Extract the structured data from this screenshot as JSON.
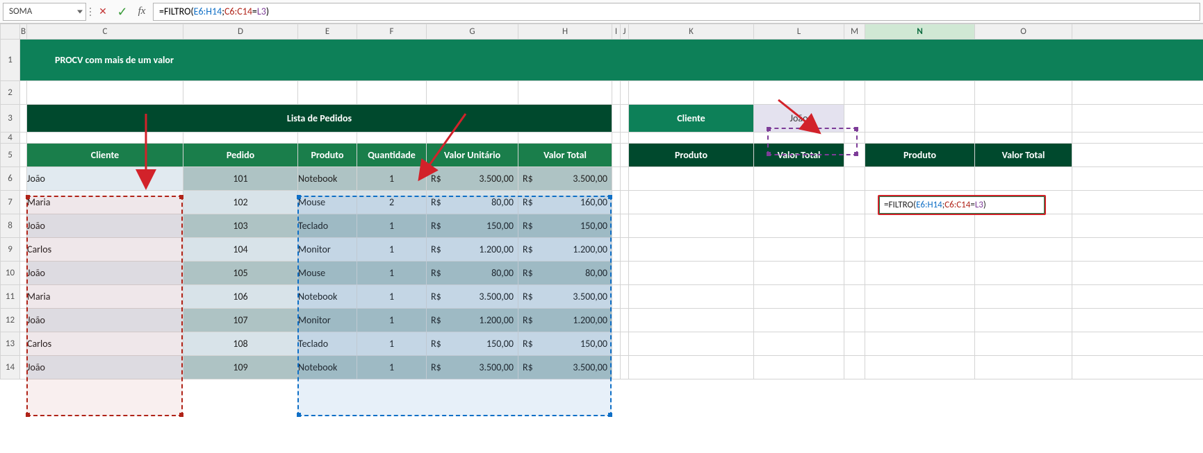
{
  "namebox": "SOMA",
  "formula": {
    "prefix": "=FILTRO(",
    "r1": "E6:H14",
    "sep": ";",
    "r2": "C6:C14",
    "eq": "=",
    "r3": "L3",
    "suffix": ")"
  },
  "columns": [
    "",
    "B",
    "C",
    "D",
    "E",
    "F",
    "G",
    "H",
    "I",
    "J",
    "K",
    "L",
    "M",
    "N",
    "O"
  ],
  "title": "PROCV com mais de um valor",
  "lista_header": "Lista de Pedidos",
  "table_headers": {
    "cliente": "Cliente",
    "pedido": "Pedido",
    "produto": "Produto",
    "quantidade": "Quantidade",
    "valor_unit": "Valor Unitário",
    "valor_total": "Valor Total"
  },
  "cliente_label": "Cliente",
  "cliente_value": "João",
  "right_headers": {
    "produto": "Produto",
    "valor_total": "Valor Total"
  },
  "currency": "R$",
  "rows": [
    {
      "cliente": "João",
      "pedido": "101",
      "produto": "Notebook",
      "qtd": "1",
      "unit": "3.500,00",
      "total": "3.500,00"
    },
    {
      "cliente": "Maria",
      "pedido": "102",
      "produto": "Mouse",
      "qtd": "2",
      "unit": "80,00",
      "total": "160,00"
    },
    {
      "cliente": "João",
      "pedido": "103",
      "produto": "Teclado",
      "qtd": "1",
      "unit": "150,00",
      "total": "150,00"
    },
    {
      "cliente": "Carlos",
      "pedido": "104",
      "produto": "Monitor",
      "qtd": "1",
      "unit": "1.200,00",
      "total": "1.200,00"
    },
    {
      "cliente": "João",
      "pedido": "105",
      "produto": "Mouse",
      "qtd": "1",
      "unit": "80,00",
      "total": "80,00"
    },
    {
      "cliente": "Maria",
      "pedido": "106",
      "produto": "Notebook",
      "qtd": "1",
      "unit": "3.500,00",
      "total": "3.500,00"
    },
    {
      "cliente": "João",
      "pedido": "107",
      "produto": "Monitor",
      "qtd": "1",
      "unit": "1.200,00",
      "total": "1.200,00"
    },
    {
      "cliente": "Carlos",
      "pedido": "108",
      "produto": "Teclado",
      "qtd": "1",
      "unit": "150,00",
      "total": "150,00"
    },
    {
      "cliente": "João",
      "pedido": "109",
      "produto": "Notebook",
      "qtd": "1",
      "unit": "3.500,00",
      "total": "3.500,00"
    }
  ],
  "row_numbers": [
    "1",
    "2",
    "3",
    "4",
    "5",
    "6",
    "7",
    "8",
    "9",
    "10",
    "11",
    "12",
    "13",
    "14"
  ],
  "chart_data": {
    "type": "table",
    "columns": [
      "Cliente",
      "Pedido",
      "Produto",
      "Quantidade",
      "Valor Unitário",
      "Valor Total"
    ],
    "data": [
      [
        "João",
        101,
        "Notebook",
        1,
        3500.0,
        3500.0
      ],
      [
        "Maria",
        102,
        "Mouse",
        2,
        80.0,
        160.0
      ],
      [
        "João",
        103,
        "Teclado",
        1,
        150.0,
        150.0
      ],
      [
        "Carlos",
        104,
        "Monitor",
        1,
        1200.0,
        1200.0
      ],
      [
        "João",
        105,
        "Mouse",
        1,
        80.0,
        80.0
      ],
      [
        "Maria",
        106,
        "Notebook",
        1,
        3500.0,
        3500.0
      ],
      [
        "João",
        107,
        "Monitor",
        1,
        1200.0,
        1200.0
      ],
      [
        "Carlos",
        108,
        "Teclado",
        1,
        150.0,
        150.0
      ],
      [
        "João",
        109,
        "Notebook",
        1,
        3500.0,
        3500.0
      ]
    ]
  }
}
